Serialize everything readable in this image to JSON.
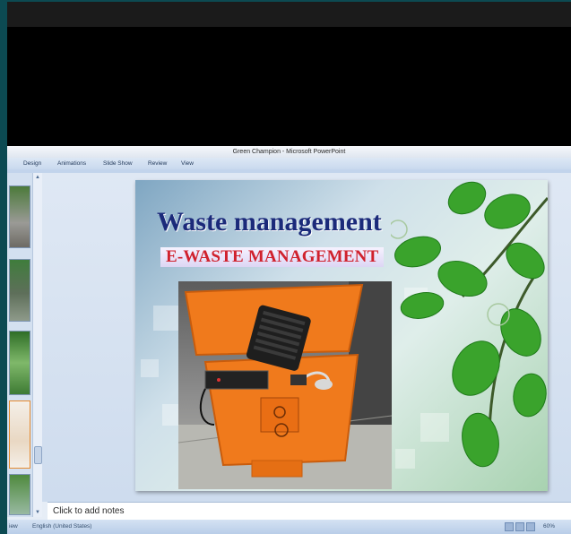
{
  "window": {
    "title": "Green Champion - Microsoft PowerPoint"
  },
  "ribbon": {
    "tabs": [
      "Design",
      "Animations",
      "Slide Show",
      "Review",
      "View"
    ]
  },
  "slide": {
    "title": "Waste management",
    "subtitle": "E-WASTE MANAGEMENT"
  },
  "notes": {
    "placeholder": "Click to add notes"
  },
  "status": {
    "view": "iew",
    "language": "English (United States)",
    "zoom": "60%"
  },
  "colors": {
    "title_text": "#1b2a7a",
    "subtitle_text": "#d0212d",
    "bin_orange": "#f07a1c",
    "leaf_green": "#3aa32c"
  }
}
